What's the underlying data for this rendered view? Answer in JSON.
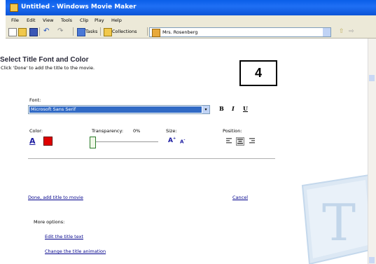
{
  "window": {
    "title": "Untitled - Windows Movie Maker"
  },
  "menu": [
    "File",
    "Edit",
    "View",
    "Tools",
    "Clip",
    "Play",
    "Help"
  ],
  "toolbar": {
    "tasks_label": "Tasks",
    "collections_label": "Collections",
    "collection_value": "Mrs. Rosenberg"
  },
  "page": {
    "heading": "Select Title Font and Color",
    "instructions": "Click 'Done' to add the title to the movie."
  },
  "callout": "4",
  "font": {
    "label": "Font:",
    "value": "Microsoft Sans Serif",
    "bold": "B",
    "italic": "I",
    "underline": "U"
  },
  "color_section": {
    "color_label": "Color:",
    "transparency_label": "Transparency:",
    "transparency_value": "0%",
    "transparency_level": 0,
    "size_label": "Size:",
    "position_label": "Position:",
    "selected_color": "#e00000",
    "text_color": "#1a1aa0"
  },
  "actions": {
    "done": "Done, add title to movie",
    "cancel": "Cancel"
  },
  "more": {
    "label": "More options:",
    "edit": "Edit the title text",
    "animation": "Change the title animation"
  },
  "icons": [
    "movie-maker-icon",
    "new-project-icon",
    "open-project-icon",
    "save-project-icon",
    "undo-icon",
    "redo-icon",
    "tasks-icon",
    "collections-icon",
    "collection-folder-icon",
    "up-folder-icon",
    "view-icon"
  ]
}
